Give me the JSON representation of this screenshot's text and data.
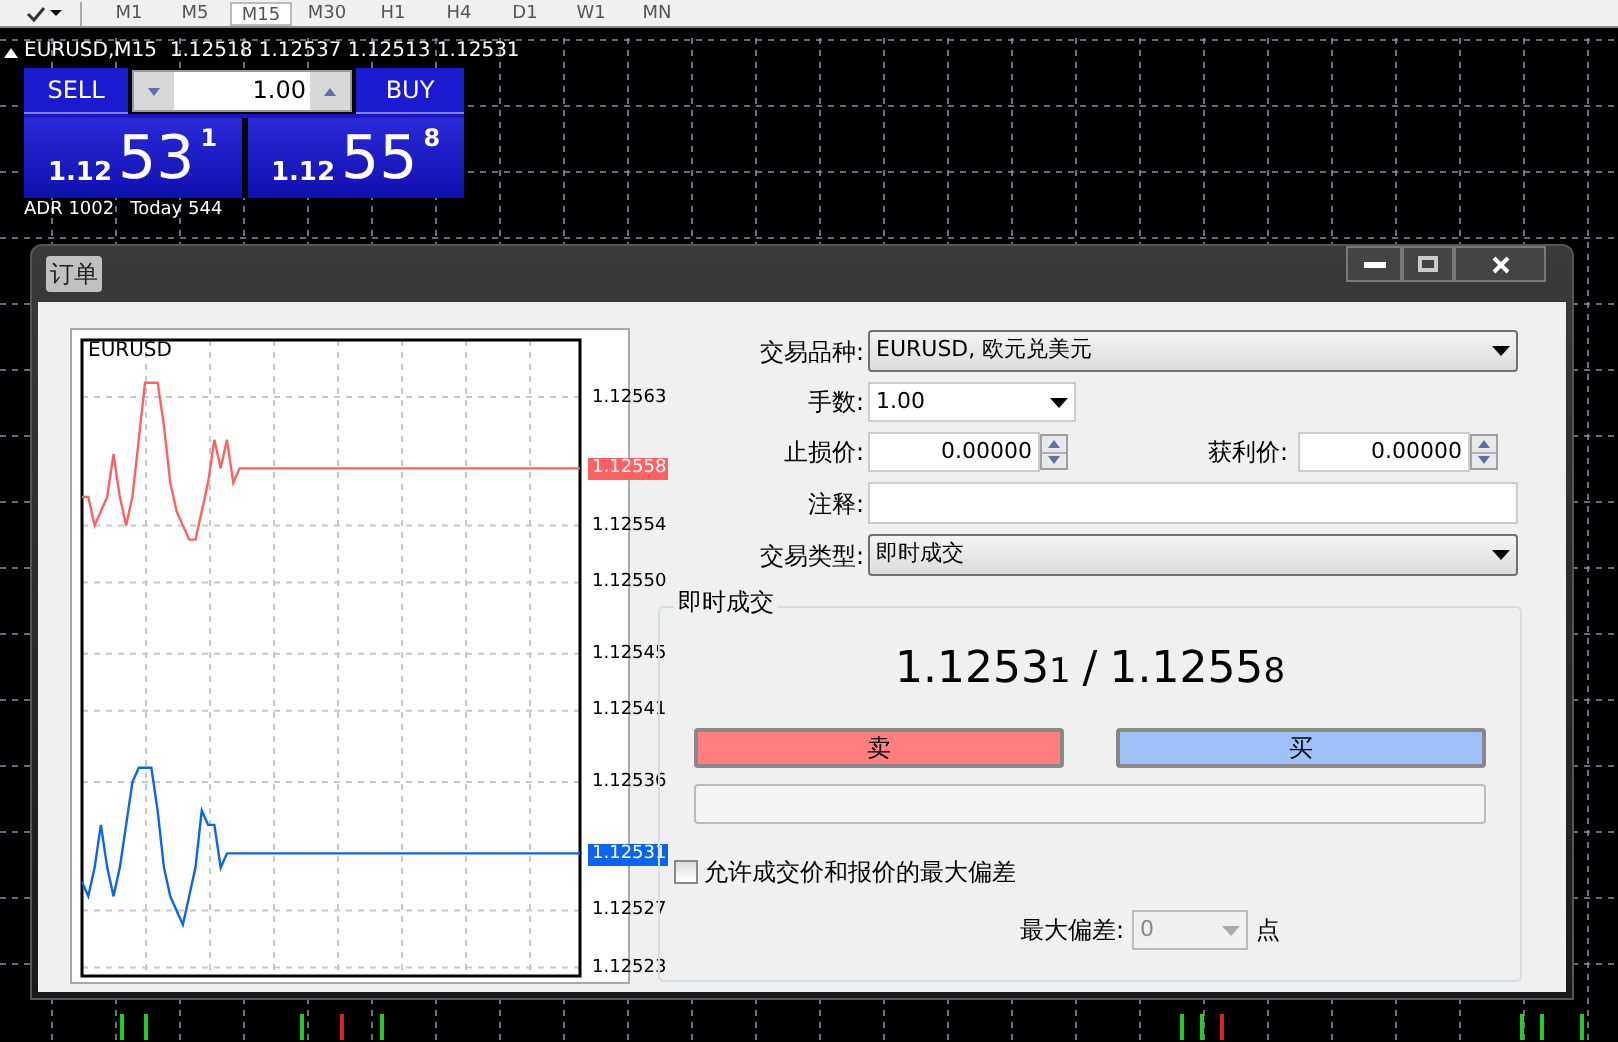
{
  "toolbar": {
    "timeframes": [
      {
        "label": "M1",
        "selected": false
      },
      {
        "label": "M5",
        "selected": false
      },
      {
        "label": "M15",
        "selected": true
      },
      {
        "label": "M30",
        "selected": false
      },
      {
        "label": "H1",
        "selected": false
      },
      {
        "label": "H4",
        "selected": false
      },
      {
        "label": "D1",
        "selected": false
      },
      {
        "label": "W1",
        "selected": false
      },
      {
        "label": "MN",
        "selected": false
      }
    ]
  },
  "chart": {
    "header": "EURUSD,M15  1.12518 1.12537 1.12513 1.12531"
  },
  "one_click": {
    "sell": "SELL",
    "buy": "BUY",
    "lot": "1.00",
    "bid": {
      "prefix": "1.12",
      "big": "53",
      "small": "1"
    },
    "ask": {
      "prefix": "1.12",
      "big": "55",
      "small": "8"
    },
    "stats": [
      "ADR 1002",
      "Today 544"
    ]
  },
  "dialog": {
    "title": "订单",
    "tick_chart": {
      "symbol": "EURUSD",
      "ask_tag": "1.12558",
      "bid_tag": "1.12531",
      "chart_data": {
        "type": "line",
        "grid": true,
        "ylim": [
          1.125224,
          1.12567
        ],
        "yticks": [
          {
            "value": 1.12563,
            "label": "1.12563"
          },
          {
            "value": 1.12554,
            "label": "1.12554"
          },
          {
            "value": 1.1255,
            "label": "1.12550"
          },
          {
            "value": 1.12545,
            "label": "1.12545"
          },
          {
            "value": 1.12541,
            "label": "1.12541"
          },
          {
            "value": 1.12536,
            "label": "1.12536"
          },
          {
            "value": 1.12527,
            "label": "1.12527"
          },
          {
            "value": 1.12523,
            "label": "1.12523"
          }
        ],
        "categories": [
          null,
          null,
          null,
          null,
          null,
          null,
          null,
          null,
          null,
          null,
          null,
          null,
          null,
          null,
          null,
          null,
          null,
          null,
          null,
          null,
          null,
          null,
          null,
          null,
          null,
          null,
          null,
          null,
          null,
          null,
          null,
          null,
          null,
          null,
          null,
          null,
          null,
          null,
          null,
          null,
          null,
          null,
          null,
          null,
          null,
          null,
          null,
          null,
          null,
          null,
          null,
          null,
          null,
          null,
          null,
          null,
          null,
          null,
          null,
          null,
          null,
          null,
          null,
          null,
          null,
          null,
          null,
          null,
          null,
          null,
          null,
          null,
          null,
          null,
          null,
          null,
          null,
          null,
          null,
          null
        ],
        "series": [
          {
            "color": "#ff6060",
            "values": [
              1.12556,
              1.12556,
              1.12554,
              1.12555,
              1.12556,
              1.12559,
              1.12556,
              1.12554,
              1.12556,
              1.1256,
              1.12564,
              1.12564,
              1.12564,
              1.12561,
              1.12557,
              1.12555,
              1.12554,
              1.12553,
              1.12553,
              1.12555,
              1.12557,
              1.1256,
              1.12558,
              1.1256,
              1.12557,
              1.12558,
              1.12558,
              1.12558,
              1.12558,
              1.12558,
              1.12558,
              1.12558,
              1.12558,
              1.12558,
              1.12558,
              1.12558,
              1.12558,
              1.12558,
              1.12558,
              1.12558,
              1.12558,
              1.12558,
              1.12558,
              1.12558,
              1.12558,
              1.12558,
              1.12558,
              1.12558,
              1.12558,
              1.12558,
              1.12558,
              1.12558,
              1.12558,
              1.12558,
              1.12558,
              1.12558,
              1.12558,
              1.12558,
              1.12558,
              1.12558,
              1.12558,
              1.12558,
              1.12558,
              1.12558,
              1.12558,
              1.12558,
              1.12558,
              1.12558,
              1.12558,
              1.12558,
              1.12558,
              1.12558,
              1.12558,
              1.12558,
              1.12558,
              1.12558,
              1.12558,
              1.12558,
              1.12558,
              1.12558
            ]
          },
          {
            "color": "#0a64f0",
            "values": [
              1.12529,
              1.12528,
              1.1253,
              1.12533,
              1.1253,
              1.12528,
              1.1253,
              1.12533,
              1.12536,
              1.12537,
              1.12537,
              1.12537,
              1.12534,
              1.1253,
              1.12528,
              1.12527,
              1.12526,
              1.12528,
              1.1253,
              1.12534,
              1.12533,
              1.12533,
              1.1253,
              1.12531,
              1.12531,
              1.12531,
              1.12531,
              1.12531,
              1.12531,
              1.12531,
              1.12531,
              1.12531,
              1.12531,
              1.12531,
              1.12531,
              1.12531,
              1.12531,
              1.12531,
              1.12531,
              1.12531,
              1.12531,
              1.12531,
              1.12531,
              1.12531,
              1.12531,
              1.12531,
              1.12531,
              1.12531,
              1.12531,
              1.12531,
              1.12531,
              1.12531,
              1.12531,
              1.12531,
              1.12531,
              1.12531,
              1.12531,
              1.12531,
              1.12531,
              1.12531,
              1.12531,
              1.12531,
              1.12531,
              1.12531,
              1.12531,
              1.12531,
              1.12531,
              1.12531,
              1.12531,
              1.12531,
              1.12531,
              1.12531,
              1.12531,
              1.12531,
              1.12531,
              1.12531,
              1.12531,
              1.12531,
              1.12531,
              1.12531
            ]
          }
        ]
      }
    },
    "form": {
      "symbol_label": "交易品种:",
      "symbol": "EURUSD, 欧元兑美元",
      "volume_label": "手数:",
      "volume": "1.00",
      "sl_label": "止损价:",
      "sl": "0.00000",
      "tp_label": "获利价:",
      "tp": "0.00000",
      "comment_label": "注释:",
      "type_label": "交易类型:",
      "type": "即时成交"
    },
    "execution": {
      "title": "即时成交",
      "bid_main": "1.1253",
      "bid_pip": "1",
      "separator": "/",
      "ask_main": "1.1255",
      "ask_pip": "8",
      "sell": "卖",
      "buy": "买",
      "deviation_check": {
        "label": "允许成交价和报价的最大偏差",
        "checked": false
      },
      "deviation_label": "最大偏差:",
      "deviation": "0",
      "deviation_disabled": true,
      "unit": "点"
    }
  }
}
